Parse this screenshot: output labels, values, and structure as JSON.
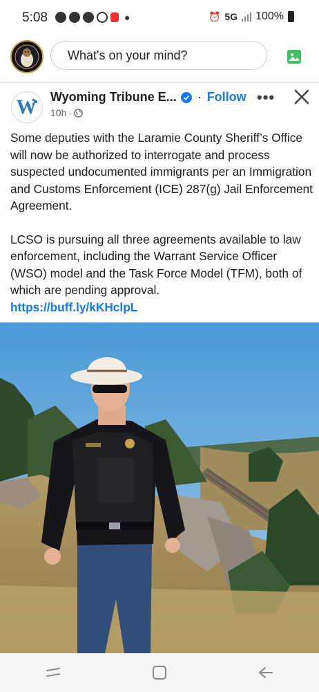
{
  "status_bar": {
    "time": "5:08",
    "network": "5G",
    "battery": "100%"
  },
  "composer": {
    "placeholder": "What's on your mind?"
  },
  "post": {
    "page_name": "Wyoming Tribune E...",
    "follow_label": "Follow",
    "time_ago": "10h",
    "separator": "·",
    "paragraph_1": "Some deputies with the Laramie County Sheriff’s Office will now be authorized to interrogate and process suspected undocumented immigrants per an Immigration and Customs Enforcement (ICE) 287(g) Jail Enforcement Agreement.",
    "paragraph_2": "LCSO is pursuing all three agreements available to law enforcement, including the Warrant Service Officer (WSO) model and the Task Force Model (TFM), both of which are pending approval.",
    "link": "https://buff.ly/kKHclpL"
  },
  "colors": {
    "accent": "#1877f2",
    "text": "#1c1e21",
    "meta": "#65676b"
  },
  "icons": [
    "photo-icon",
    "verified-icon",
    "globe-icon",
    "more-icon",
    "close-icon",
    "recent-apps-icon",
    "home-icon",
    "back-icon"
  ]
}
